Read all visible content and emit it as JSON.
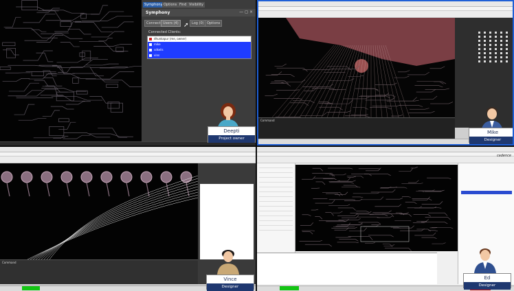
{
  "symphony_panel": {
    "tabs": [
      "Symphony",
      "Options",
      "Find",
      "Visibility"
    ],
    "title": "Symphony",
    "buttons": [
      "Connect",
      "Users (4)",
      "Log (0)",
      "Options"
    ],
    "clients_heading": "Connected Clients:",
    "clients": [
      {
        "name": "dhunkapur (me, owner)",
        "color": "#cc2222",
        "selected": false
      },
      {
        "name": "mike",
        "color": "#3344cc",
        "selected": true
      },
      {
        "name": "sdkells",
        "color": "#3344cc",
        "selected": true
      },
      {
        "name": "vins",
        "color": "#3344cc",
        "selected": true
      }
    ]
  },
  "participants": [
    {
      "name": "Deepti",
      "role": "Project owner"
    },
    {
      "name": "Mike",
      "role": "Designer"
    },
    {
      "name": "Vince",
      "role": "Designer"
    },
    {
      "name": "Ed",
      "role": "Designer"
    }
  ],
  "colors": {
    "pcb_trace": "#6a5a60",
    "pcb_plane": "#8a4a4a",
    "selection_blue": "#1f3cff",
    "status_green": "#13c513",
    "status_red": "#e01010",
    "badge_role_bg": "#1f3870",
    "focus_border": "#1e5fd6"
  },
  "q3": {
    "command_label": "Command"
  },
  "q2": {
    "command_label": "Command"
  },
  "q4": {
    "brand": "cadence"
  }
}
